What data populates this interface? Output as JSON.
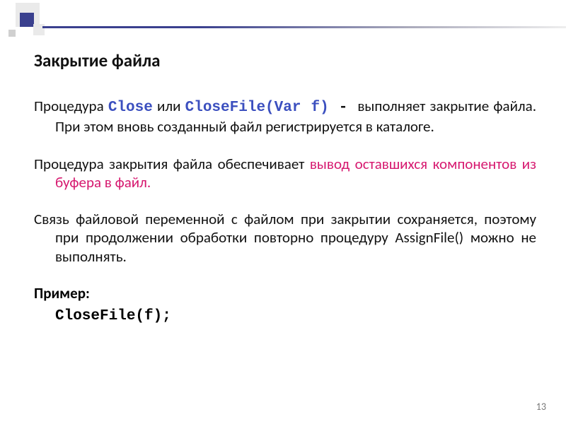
{
  "heading": "Закрытие файла",
  "para1": {
    "lead": "Процедура ",
    "code1": "Close",
    "mid1": " или ",
    "code2": "CloseFile(Var f)",
    "dash": " - ",
    "tail": "выполняет закрытие файла. При этом вновь созданный файл регистрируется в каталоге."
  },
  "para2": {
    "lead": "Процедура закрытия файла обеспечивает ",
    "highlight": "вывод оставшихся компонентов из буфера в файл."
  },
  "para3": "Связь файловой переменной с файлом при закрытии сохраняется, поэтому при продолжении обработки повторно процедуру AssignFile() можно не выполнять.",
  "example_label": "Пример:",
  "example_code": "CloseFile(f);",
  "page_number": "13"
}
